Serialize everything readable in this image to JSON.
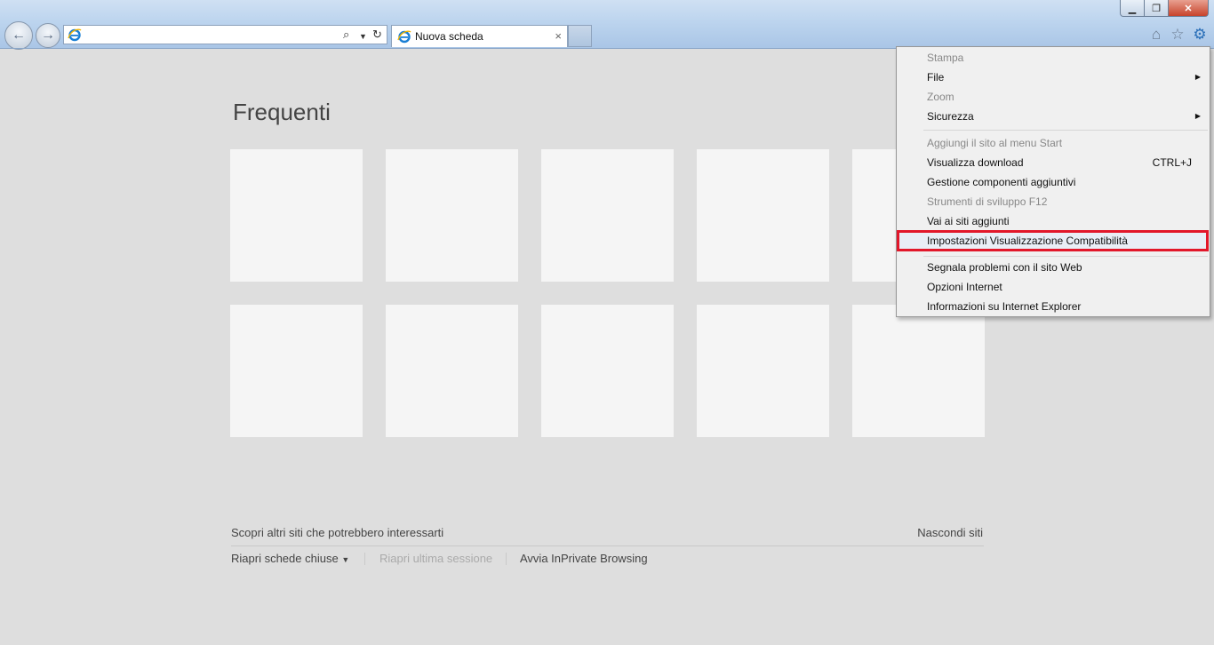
{
  "browser": {
    "address_value": "",
    "tab_title": "Nuova scheda",
    "tab_close": "×",
    "window_controls": {
      "minimize": "▁",
      "restore": "❐",
      "close": "✕"
    },
    "icons": [
      "back-arrow-icon",
      "forward-arrow-icon",
      "ie-logo-icon",
      "search-icon",
      "dropdown-arrow-icon",
      "refresh-icon",
      "close-icon",
      "home-icon",
      "favorites-star-icon",
      "gear-icon"
    ]
  },
  "page": {
    "title": "Frequenti",
    "discover_text": "Scopri altri siti che potrebbero interessarti",
    "hide_sites": "Nascondi siti",
    "reopen_closed_tabs": "Riapri schede chiuse",
    "reopen_last_session": "Riapri ultima sessione",
    "inprivate": "Avvia InPrivate Browsing",
    "tile_count": 10
  },
  "menu": {
    "items": [
      {
        "label": "Stampa",
        "disabled": true
      },
      {
        "label": "File",
        "submenu": true
      },
      {
        "label": "Zoom",
        "disabled": true
      },
      {
        "label": "Sicurezza",
        "submenu": true
      },
      {
        "label": "Aggiungi il sito al menu Start",
        "disabled": true
      },
      {
        "label": "Visualizza download",
        "shortcut": "CTRL+J"
      },
      {
        "label": "Gestione componenti aggiuntivi"
      },
      {
        "label": "Strumenti di sviluppo F12",
        "disabled": true
      },
      {
        "label": "Vai ai siti aggiunti"
      },
      {
        "label": "Impostazioni Visualizzazione Compatibilità",
        "highlighted": true
      },
      {
        "label": "Segnala problemi con il sito Web"
      },
      {
        "label": "Opzioni Internet"
      },
      {
        "label": "Informazioni su Internet Explorer"
      }
    ],
    "highlight_color": "#e2172a"
  }
}
